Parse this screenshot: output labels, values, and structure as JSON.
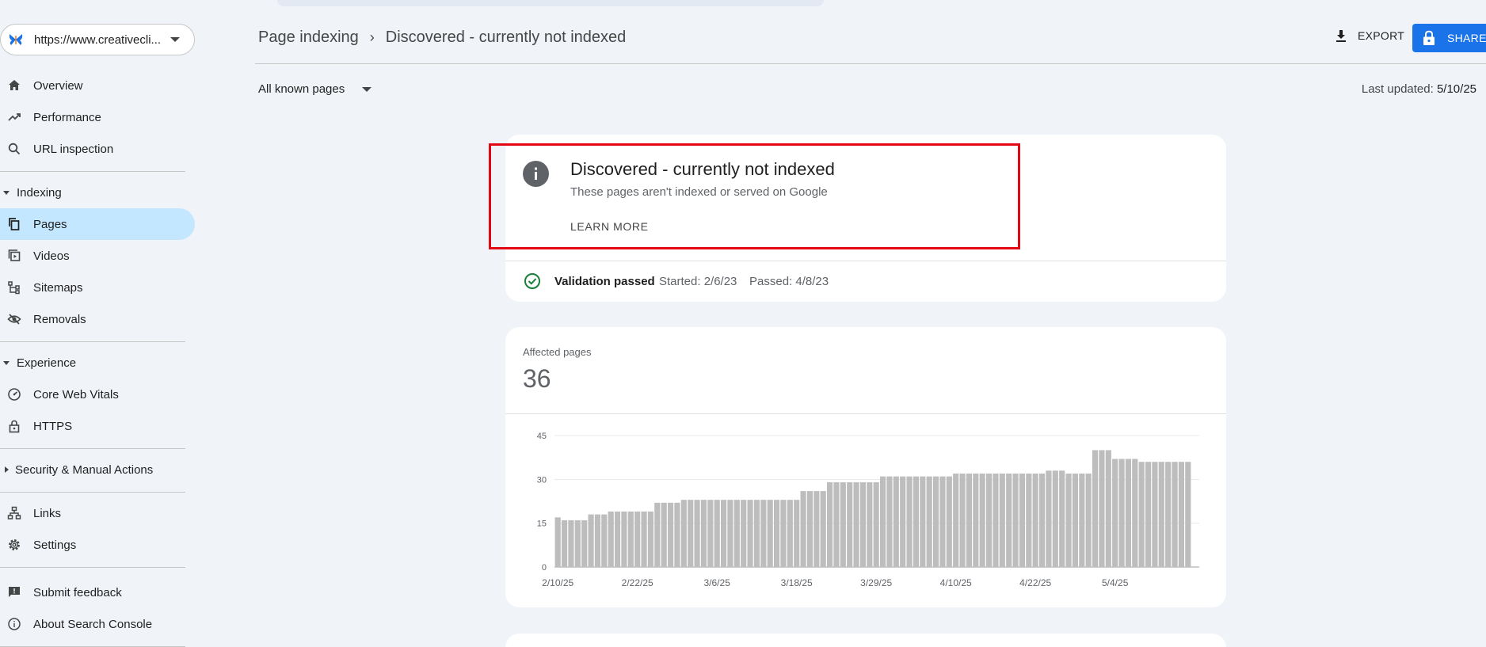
{
  "property": {
    "url": "https://www.creativecli...",
    "logo_icon": "butterfly-logo"
  },
  "sidebar": {
    "items_top": [
      {
        "label": "Overview",
        "icon": "home-icon"
      },
      {
        "label": "Performance",
        "icon": "trending-up-icon"
      },
      {
        "label": "URL inspection",
        "icon": "search-icon"
      }
    ],
    "indexing": {
      "heading": "Indexing",
      "items": [
        {
          "label": "Pages",
          "icon": "pages-icon",
          "active": true
        },
        {
          "label": "Videos",
          "icon": "video-icon"
        },
        {
          "label": "Sitemaps",
          "icon": "sitemap-icon"
        },
        {
          "label": "Removals",
          "icon": "eye-off-icon"
        }
      ]
    },
    "experience": {
      "heading": "Experience",
      "items": [
        {
          "label": "Core Web Vitals",
          "icon": "speedometer-icon"
        },
        {
          "label": "HTTPS",
          "icon": "lock-icon"
        }
      ]
    },
    "security": {
      "heading": "Security & Manual Actions"
    },
    "items_bottom": [
      {
        "label": "Links",
        "icon": "links-icon"
      },
      {
        "label": "Settings",
        "icon": "gear-icon"
      }
    ],
    "items_footer": [
      {
        "label": "Submit feedback",
        "icon": "feedback-icon"
      },
      {
        "label": "About Search Console",
        "icon": "info-icon"
      }
    ]
  },
  "header": {
    "breadcrumb_parent": "Page indexing",
    "breadcrumb_separator": "›",
    "breadcrumb_current": "Discovered - currently not indexed",
    "export_label": "EXPORT",
    "share_label": "SHARE"
  },
  "filter": {
    "label": "All known pages"
  },
  "last_updated": {
    "label": "Last updated:",
    "value": "5/10/25"
  },
  "status_card": {
    "title": "Discovered - currently not indexed",
    "description": "These pages aren't indexed or served on Google",
    "learn_more": "LEARN MORE",
    "validation_label": "Validation passed",
    "started": "Started: 2/6/23",
    "passed": "Passed: 4/8/23"
  },
  "affected": {
    "label": "Affected pages",
    "value": "36"
  },
  "colors": {
    "accent": "#1a73e8",
    "active_nav": "#c2e7ff",
    "bar": "#bdbdbd",
    "highlight_border": "#e30613",
    "success": "#188038"
  },
  "chart_data": {
    "type": "bar",
    "title": "",
    "xlabel": "",
    "ylabel": "",
    "ylim": [
      0,
      45
    ],
    "yticks": [
      "0",
      "15",
      "30",
      "45"
    ],
    "xticks": [
      "2/10/25",
      "2/22/25",
      "3/6/25",
      "3/18/25",
      "3/29/25",
      "4/10/25",
      "4/22/25",
      "5/4/25"
    ],
    "grid": true,
    "start_date": "2025-02-10",
    "values": [
      17,
      16,
      16,
      16,
      16,
      18,
      18,
      18,
      19,
      19,
      19,
      19,
      19,
      19,
      19,
      22,
      22,
      22,
      22,
      23,
      23,
      23,
      23,
      23,
      23,
      23,
      23,
      23,
      23,
      23,
      23,
      23,
      23,
      23,
      23,
      23,
      23,
      26,
      26,
      26,
      26,
      29,
      29,
      29,
      29,
      29,
      29,
      29,
      29,
      31,
      31,
      31,
      31,
      31,
      31,
      31,
      31,
      31,
      31,
      31,
      32,
      32,
      32,
      32,
      32,
      32,
      32,
      32,
      32,
      32,
      32,
      32,
      32,
      32,
      33,
      33,
      33,
      32,
      32,
      32,
      32,
      40,
      40,
      40,
      37,
      37,
      37,
      37,
      36,
      36,
      36,
      36,
      36,
      36,
      36,
      36
    ]
  }
}
